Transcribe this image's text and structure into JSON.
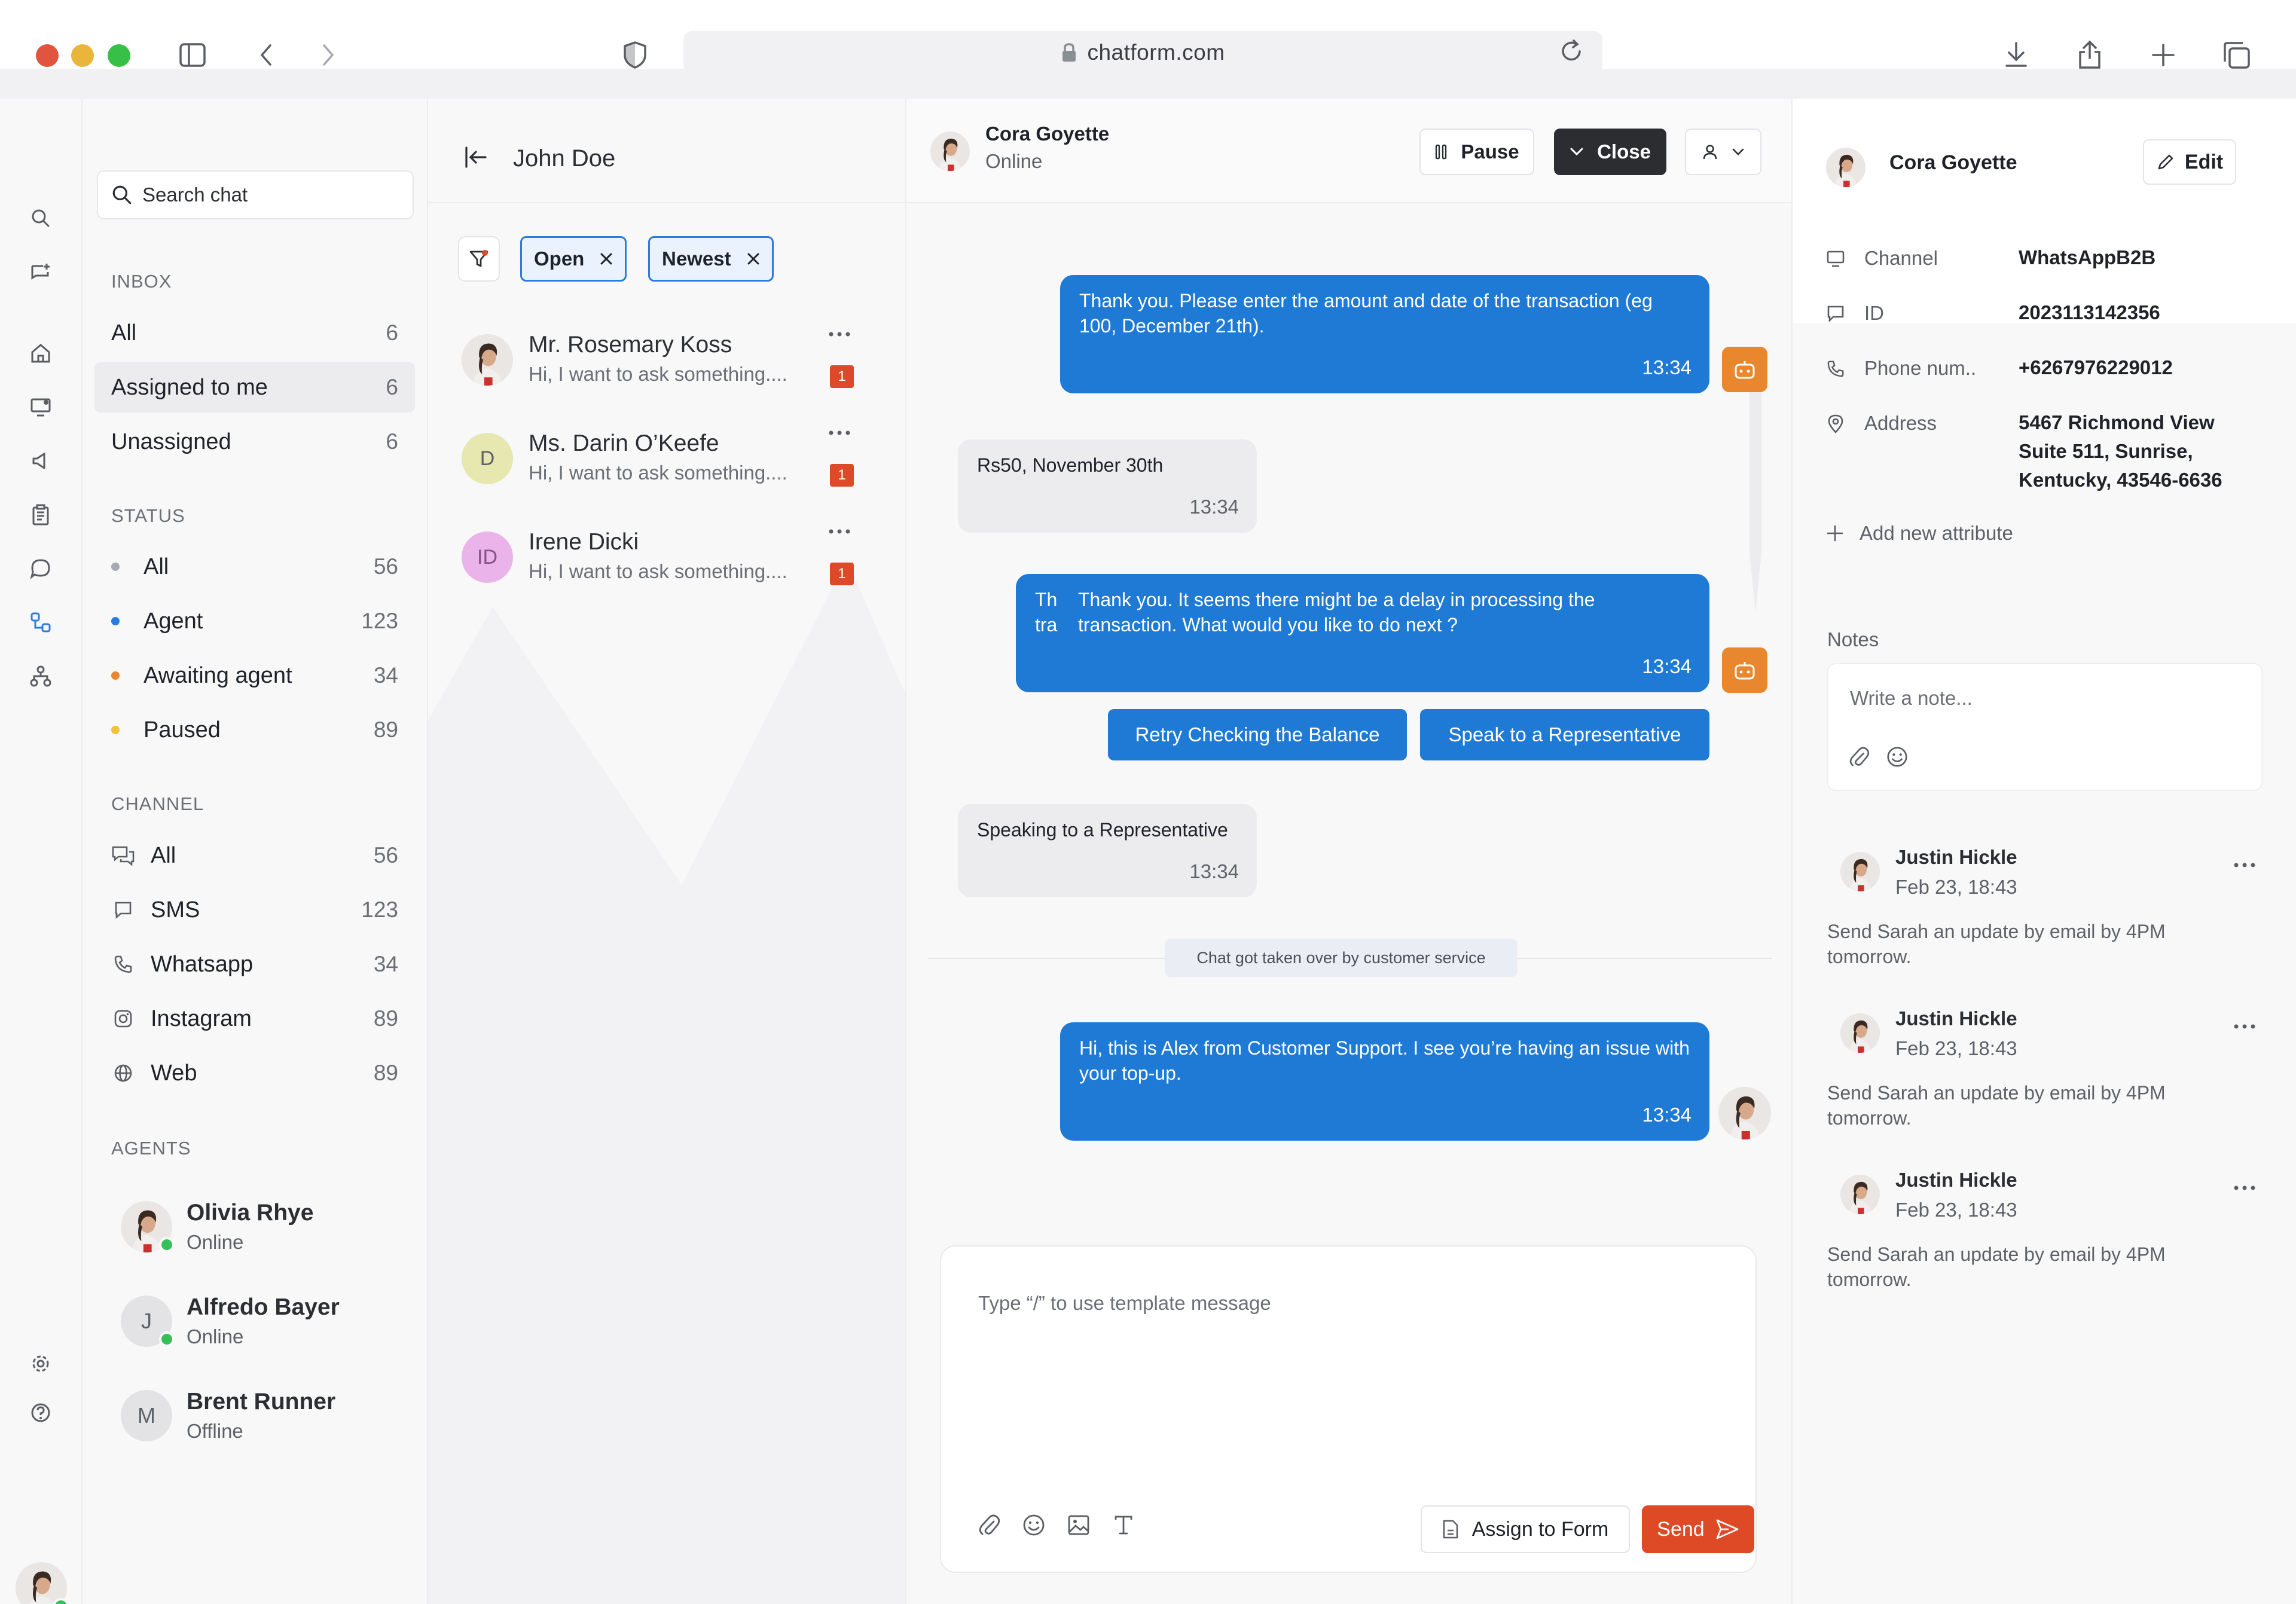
{
  "browser": {
    "url": "chatform.com"
  },
  "rail": {
    "icons": [
      "search-icon",
      "chat-add-icon",
      "home-icon",
      "monitor-icon",
      "megaphone-icon",
      "clipboard-icon",
      "chat-bubble-icon",
      "flow-icon",
      "org-chart-icon",
      "settings-icon",
      "help-icon"
    ]
  },
  "sidebar": {
    "search_label": "Search chat",
    "inbox_heading": "INBOX",
    "inbox": [
      {
        "label": "All",
        "count": "6"
      },
      {
        "label": "Assigned to me",
        "count": "6"
      },
      {
        "label": "Unassigned",
        "count": "6"
      }
    ],
    "status_heading": "STATUS",
    "status": [
      {
        "label": "All",
        "count": "56",
        "color": "#a7aab0"
      },
      {
        "label": "Agent",
        "count": "123",
        "color": "#2b7be0"
      },
      {
        "label": "Awaiting agent",
        "count": "34",
        "color": "#e8872d"
      },
      {
        "label": "Paused",
        "count": "89",
        "color": "#f2c23d"
      }
    ],
    "channel_heading": "CHANNEL",
    "channels": [
      {
        "label": "All",
        "count": "56",
        "icon": "chats-icon"
      },
      {
        "label": "SMS",
        "count": "123",
        "icon": "sms-icon"
      },
      {
        "label": "Whatsapp",
        "count": "34",
        "icon": "phone-icon"
      },
      {
        "label": "Instagram",
        "count": "89",
        "icon": "instagram-icon"
      },
      {
        "label": "Web",
        "count": "89",
        "icon": "globe-icon"
      }
    ],
    "agents_heading": "AGENTS",
    "agents": [
      {
        "name": "Olivia Rhye",
        "status": "Online",
        "initial": ""
      },
      {
        "name": "Alfredo Bayer",
        "status": "Online",
        "initial": "J"
      },
      {
        "name": "Brent Runner",
        "status": "Offline",
        "initial": "M"
      }
    ]
  },
  "conversations": {
    "owner": "John Doe",
    "filters": [
      {
        "label": "Open"
      },
      {
        "label": "Newest"
      }
    ],
    "items": [
      {
        "name": "Mr. Rosemary Koss",
        "preview": "Hi, I want to ask something....",
        "unread": "1",
        "initials": "",
        "avatar_color": "#e6e6e8"
      },
      {
        "name": "Ms. Darin O’Keefe",
        "preview": "Hi, I want to ask something....",
        "unread": "1",
        "initials": "D",
        "avatar_color": "#e7e7b0"
      },
      {
        "name": "Irene Dicki",
        "preview": "Hi, I want to ask something....",
        "unread": "1",
        "initials": "ID",
        "avatar_color": "#eab3e9"
      }
    ]
  },
  "chat": {
    "contact_name": "Cora Goyette",
    "contact_status": "Online",
    "pause_label": "Pause",
    "close_label": "Close",
    "messages": [
      {
        "text": "Thank you. Please enter the amount and date of the transaction (eg 100, December 21th).",
        "time": "13:34",
        "side": "out"
      },
      {
        "text": "Rs50, November 30th",
        "time": "13:34",
        "side": "in"
      },
      {
        "text": "Thank you. It seems there might be a delay in processing the transaction. What would you like to do next ?",
        "time": "13:34",
        "side": "out",
        "overlap_text": "Th\ntra"
      },
      {
        "text": "Speaking to a Representative",
        "time": "13:34",
        "side": "in"
      },
      {
        "text": "Hi, this is Alex from Customer Support. I see you’re having an issue with your top-up.",
        "time": "13:34",
        "side": "out"
      }
    ],
    "quick_replies": [
      "Retry Checking the Balance",
      "Speak to a Representative"
    ],
    "system_note": "Chat got taken over by customer service",
    "composer_placeholder": "Type “/” to use template message",
    "assign_form_label": "Assign to Form",
    "send_label": "Send"
  },
  "details": {
    "name": "Cora Goyette",
    "edit_label": "Edit",
    "attributes": [
      {
        "key": "Channel",
        "value": "WhatsAppB2B",
        "icon": "monitor-icon"
      },
      {
        "key": "ID",
        "value": "2023113142356",
        "icon": "id-icon"
      },
      {
        "key": "Phone num..",
        "value": "+6267976229012",
        "icon": "phone-icon"
      },
      {
        "key": "Address",
        "value": "5467 Richmond View Suite 511, Sunrise, Kentucky, 43546-6636",
        "icon": "location-icon"
      }
    ],
    "add_attribute_label": "Add new attribute",
    "notes_heading": "Notes",
    "note_placeholder": "Write a note...",
    "notes": [
      {
        "author": "Justin Hickle",
        "date": "Feb 23, 18:43",
        "text": "Send Sarah an update by email by 4PM tomorrow."
      },
      {
        "author": "Justin Hickle",
        "date": "Feb 23, 18:43",
        "text": "Send Sarah an update by email by 4PM tomorrow."
      },
      {
        "author": "Justin Hickle",
        "date": "Feb 23, 18:43",
        "text": "Send Sarah an update by email by 4PM tomorrow."
      }
    ]
  }
}
